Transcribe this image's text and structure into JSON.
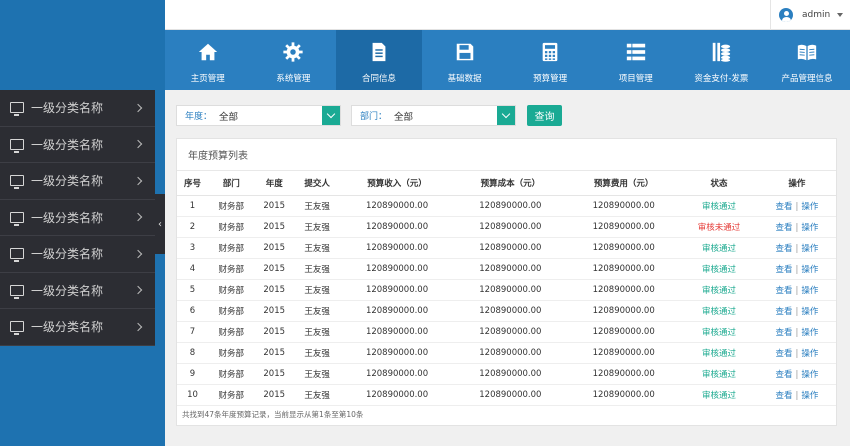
{
  "user": {
    "name": "admin"
  },
  "nav": [
    {
      "label": "主页管理",
      "icon": "home-icon"
    },
    {
      "label": "系统管理",
      "icon": "gear-icon"
    },
    {
      "label": "合同信息",
      "icon": "document-icon"
    },
    {
      "label": "基础数据",
      "icon": "floppy-disk-icon"
    },
    {
      "label": "预算管理",
      "icon": "calculator-icon"
    },
    {
      "label": "项目管理",
      "icon": "list-icon"
    },
    {
      "label": "资金支付-发票",
      "icon": "coins-icon"
    },
    {
      "label": "产品管理信息",
      "icon": "book-icon"
    }
  ],
  "nav_active": 2,
  "sidebar": {
    "items": [
      {
        "label": "一级分类名称"
      },
      {
        "label": "一级分类名称"
      },
      {
        "label": "一级分类名称"
      },
      {
        "label": "一级分类名称"
      },
      {
        "label": "一级分类名称"
      },
      {
        "label": "一级分类名称"
      },
      {
        "label": "一级分类名称"
      }
    ],
    "collapse_glyph": "‹"
  },
  "filters": {
    "year": {
      "label": "年度：",
      "value": "全部"
    },
    "dept": {
      "label": "部门：",
      "value": "全部"
    },
    "query_label": "查询"
  },
  "panel": {
    "title": "年度预算列表",
    "columns": [
      "序号",
      "部门",
      "年度",
      "提交人",
      "预算收入（元）",
      "预算成本（元）",
      "预算费用（元）",
      "状态",
      "操作"
    ],
    "rows": [
      {
        "no": "1",
        "dept": "财务部",
        "year": "2015",
        "submitter": "王友强",
        "income": "120890000.00",
        "cost": "120890000.00",
        "expense": "120890000.00",
        "status": "审核通过",
        "status_ok": true
      },
      {
        "no": "2",
        "dept": "财务部",
        "year": "2015",
        "submitter": "王友强",
        "income": "120890000.00",
        "cost": "120890000.00",
        "expense": "120890000.00",
        "status": "审核未通过",
        "status_ok": false
      },
      {
        "no": "3",
        "dept": "财务部",
        "year": "2015",
        "submitter": "王友强",
        "income": "120890000.00",
        "cost": "120890000.00",
        "expense": "120890000.00",
        "status": "审核通过",
        "status_ok": true
      },
      {
        "no": "4",
        "dept": "财务部",
        "year": "2015",
        "submitter": "王友强",
        "income": "120890000.00",
        "cost": "120890000.00",
        "expense": "120890000.00",
        "status": "审核通过",
        "status_ok": true
      },
      {
        "no": "5",
        "dept": "财务部",
        "year": "2015",
        "submitter": "王友强",
        "income": "120890000.00",
        "cost": "120890000.00",
        "expense": "120890000.00",
        "status": "审核通过",
        "status_ok": true
      },
      {
        "no": "6",
        "dept": "财务部",
        "year": "2015",
        "submitter": "王友强",
        "income": "120890000.00",
        "cost": "120890000.00",
        "expense": "120890000.00",
        "status": "审核通过",
        "status_ok": true
      },
      {
        "no": "7",
        "dept": "财务部",
        "year": "2015",
        "submitter": "王友强",
        "income": "120890000.00",
        "cost": "120890000.00",
        "expense": "120890000.00",
        "status": "审核通过",
        "status_ok": true
      },
      {
        "no": "8",
        "dept": "财务部",
        "year": "2015",
        "submitter": "王友强",
        "income": "120890000.00",
        "cost": "120890000.00",
        "expense": "120890000.00",
        "status": "审核通过",
        "status_ok": true
      },
      {
        "no": "9",
        "dept": "财务部",
        "year": "2015",
        "submitter": "王友强",
        "income": "120890000.00",
        "cost": "120890000.00",
        "expense": "120890000.00",
        "status": "审核通过",
        "status_ok": true
      },
      {
        "no": "10",
        "dept": "财务部",
        "year": "2015",
        "submitter": "王友强",
        "income": "120890000.00",
        "cost": "120890000.00",
        "expense": "120890000.00",
        "status": "审核通过",
        "status_ok": true
      }
    ],
    "action_view": "查看",
    "action_separator": "|",
    "action_op": "操作",
    "footer": "共找到47条年度预算记录，当前显示从第1条至第10条"
  },
  "colors": {
    "nav_bg": "#2b7fc0",
    "nav_active": "#1d6aa6",
    "accent_green": "#1aaa94",
    "status_ok": "#1aa98f",
    "status_bad": "#e53935",
    "sidebar_bg": "#2c2d33",
    "left_bg": "#1e72b0"
  }
}
